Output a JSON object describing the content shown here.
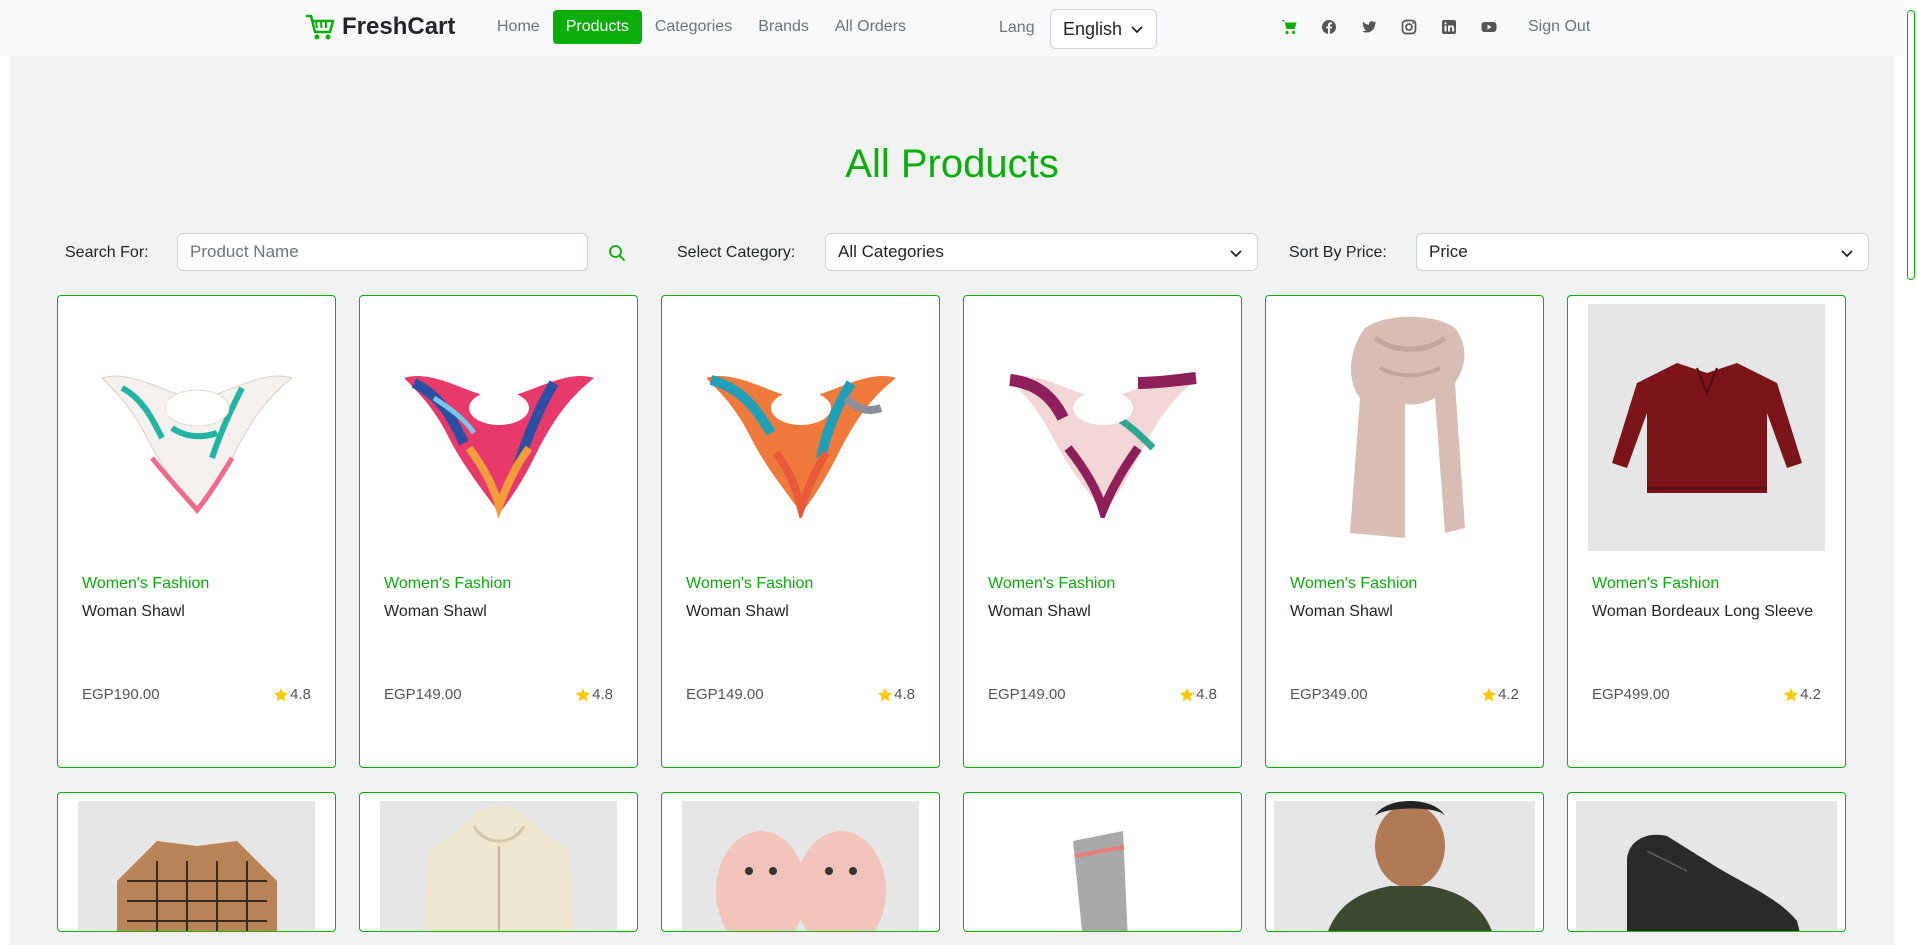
{
  "brand": {
    "name": "FreshCart"
  },
  "nav": {
    "links": [
      "Home",
      "Products",
      "Categories",
      "Brands",
      "All Orders"
    ],
    "lang_label": "Lang",
    "lang_value": "English",
    "sign_out": "Sign Out"
  },
  "social_icons": [
    "cart-icon",
    "facebook-icon",
    "twitter-icon",
    "instagram-icon",
    "linkedin-icon",
    "youtube-icon"
  ],
  "page": {
    "title": "All Products"
  },
  "filters": {
    "search_label": "Search For:",
    "search_placeholder": "Product Name",
    "category_label": "Select Category:",
    "category_value": "All Categories",
    "sort_label": "Sort By Price:",
    "sort_value": "Price"
  },
  "products": [
    {
      "category": "Women's Fashion",
      "name": "Woman Shawl",
      "price": "EGP190.00",
      "rating": "4.8"
    },
    {
      "category": "Women's Fashion",
      "name": "Woman Shawl",
      "price": "EGP149.00",
      "rating": "4.8"
    },
    {
      "category": "Women's Fashion",
      "name": "Woman Shawl",
      "price": "EGP149.00",
      "rating": "4.8"
    },
    {
      "category": "Women's Fashion",
      "name": "Woman Shawl",
      "price": "EGP149.00",
      "rating": "4.8"
    },
    {
      "category": "Women's Fashion",
      "name": "Woman Shawl",
      "price": "EGP349.00",
      "rating": "4.2"
    },
    {
      "category": "Women's Fashion",
      "name": "Woman Bordeaux Long Sleeve",
      "price": "EGP499.00",
      "rating": "4.2"
    }
  ],
  "colors": {
    "accent": "#0aad0a",
    "star": "#ffc908",
    "background": "#f0f3f2"
  }
}
